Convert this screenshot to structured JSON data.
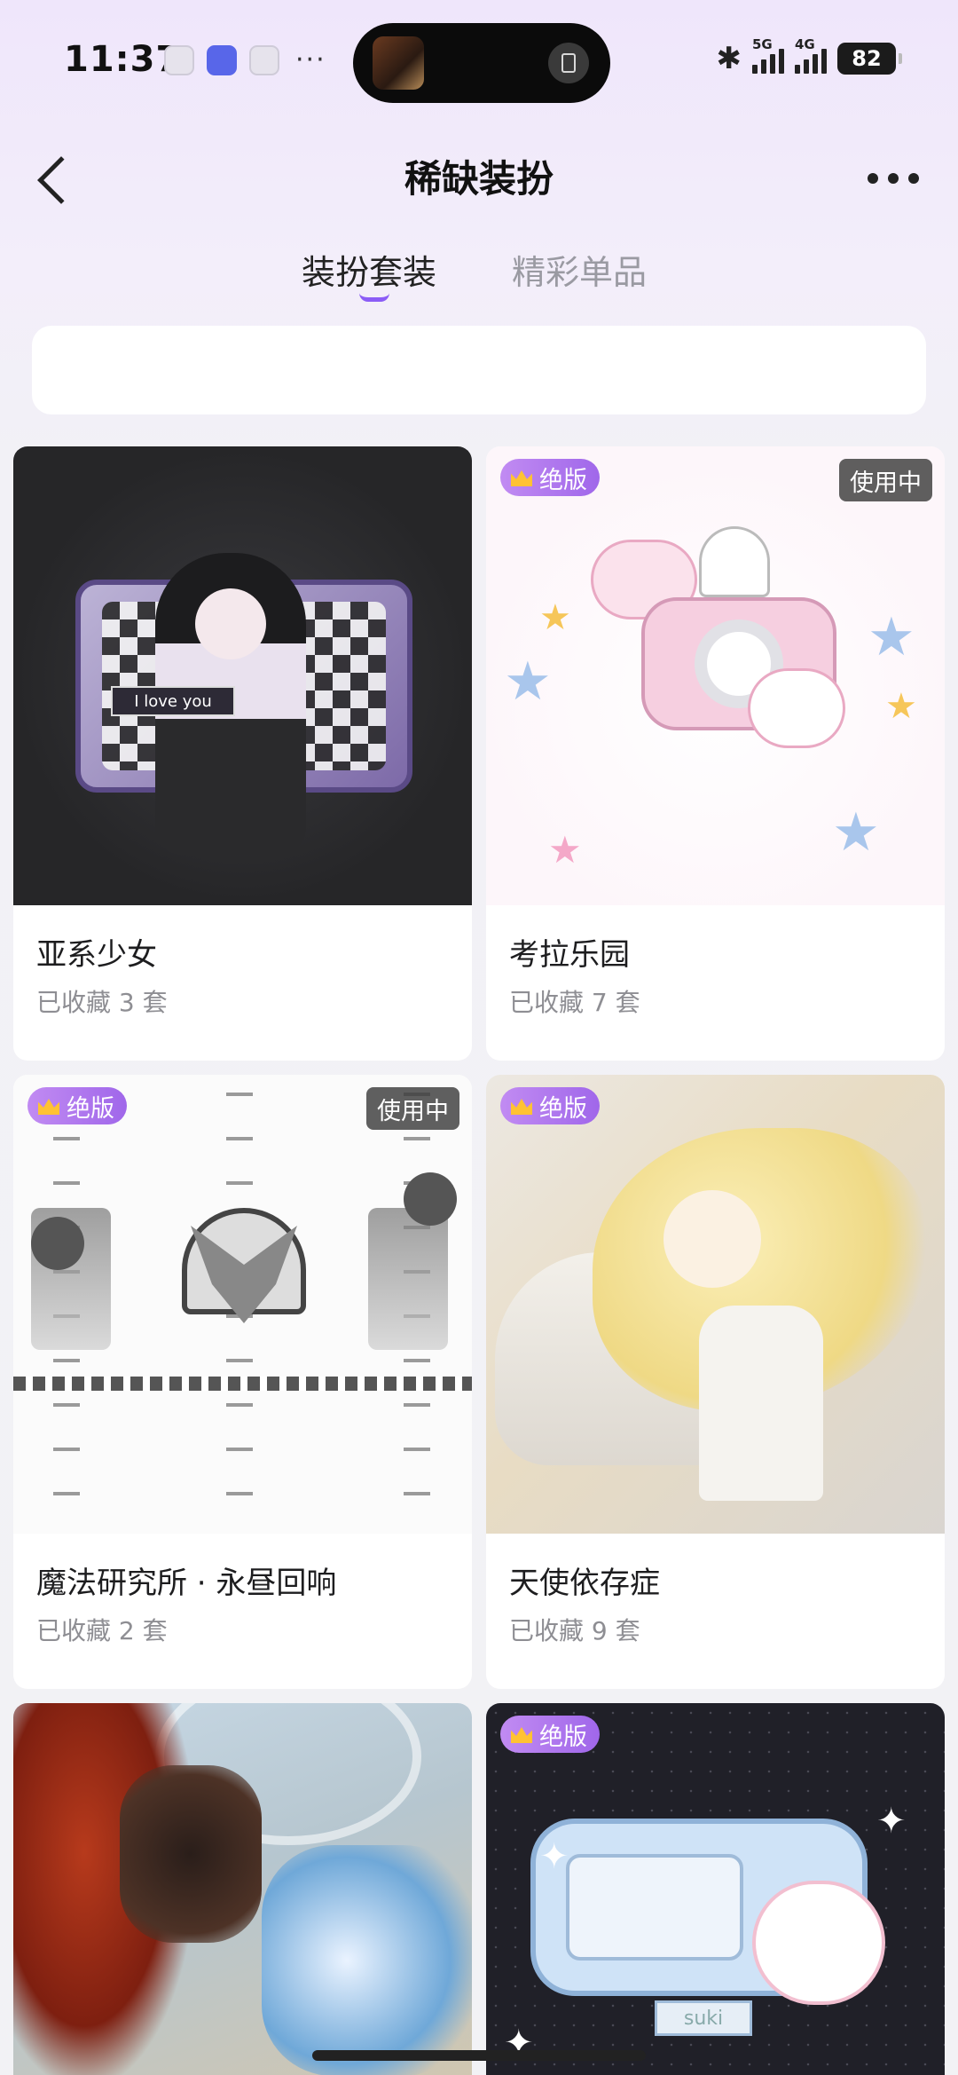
{
  "status_bar": {
    "time": "11:37",
    "notif_more": "···",
    "signal_1": "5G",
    "signal_2": "4G",
    "battery": "82"
  },
  "header": {
    "title": "稀缺装扮"
  },
  "tabs": [
    {
      "label": "装扮套装",
      "active": true
    },
    {
      "label": "精彩单品",
      "active": false
    }
  ],
  "badges": {
    "out_of_print": "绝版",
    "in_use": "使用中"
  },
  "cards": [
    {
      "name": "亚系少女",
      "count": "已收藏 3 套"
    },
    {
      "name": "考拉乐园",
      "count": "已收藏 7 套"
    },
    {
      "name": "魔法研究所 · 永昼回响",
      "count": "已收藏 2 套"
    },
    {
      "name": "天使依存症",
      "count": "已收藏 9 套"
    },
    {
      "name": "",
      "count": ""
    },
    {
      "name": "",
      "count": ""
    }
  ],
  "art_text": {
    "card1_label": "I love you",
    "card6_label": "suki"
  },
  "colors": {
    "accent": "#8b5cf6",
    "badge_gradient_start": "#c18bf2",
    "badge_gradient_end": "#a067ea",
    "crown": "#ffc233"
  }
}
